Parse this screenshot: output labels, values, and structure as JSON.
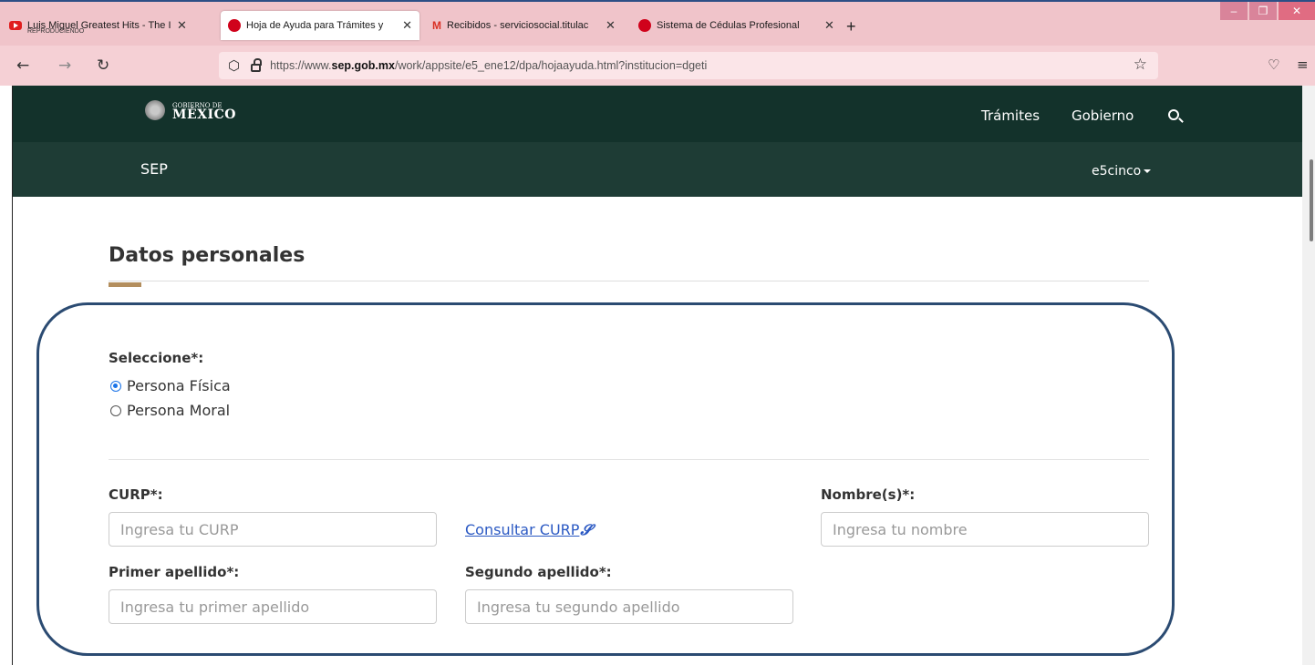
{
  "browser": {
    "tabs": [
      {
        "title": "Luis Miguel Greatest Hits - The I",
        "subtitle": "REPRODUCIENDO"
      },
      {
        "title": "Hoja de Ayuda para Trámites y",
        "active": true
      },
      {
        "title": "Recibidos - serviciosocial.titulac"
      },
      {
        "title": "Sistema de Cédulas Profesional"
      }
    ],
    "new_tab": "+",
    "url_prefix": "https://www.",
    "url_domain": "sep.gob.mx",
    "url_path": "/work/appsite/e5_ene12/dpa/hojaayuda.html?institucion=dgeti"
  },
  "header": {
    "logo_line1": "GOBIERNO DE",
    "logo_line2": "MÉXICO",
    "nav": [
      "Trámites",
      "Gobierno"
    ],
    "section": "SEP",
    "user": "e5cinco"
  },
  "main": {
    "title": "Datos personales",
    "select_label": "Seleccione*:",
    "options": [
      {
        "label": "Persona Física",
        "selected": true
      },
      {
        "label": "Persona Moral",
        "selected": false
      }
    ],
    "curp_label": "CURP*:",
    "curp_placeholder": "Ingresa tu CURP",
    "consult_link": "Consultar CURP",
    "nombre_label": "Nombre(s)*:",
    "nombre_placeholder": "Ingresa tu nombre",
    "primer_label": "Primer apellido*:",
    "primer_placeholder": "Ingresa tu primer apellido",
    "segundo_label": "Segundo apellido*:",
    "segundo_placeholder": "Ingresa tu segundo apellido"
  },
  "colors": {
    "gob_bar": "#13322b",
    "sep_bar": "#1e3c35",
    "accent": "#b38e5d",
    "highlight_border": "#2b4b72",
    "link": "#2b59c3"
  }
}
